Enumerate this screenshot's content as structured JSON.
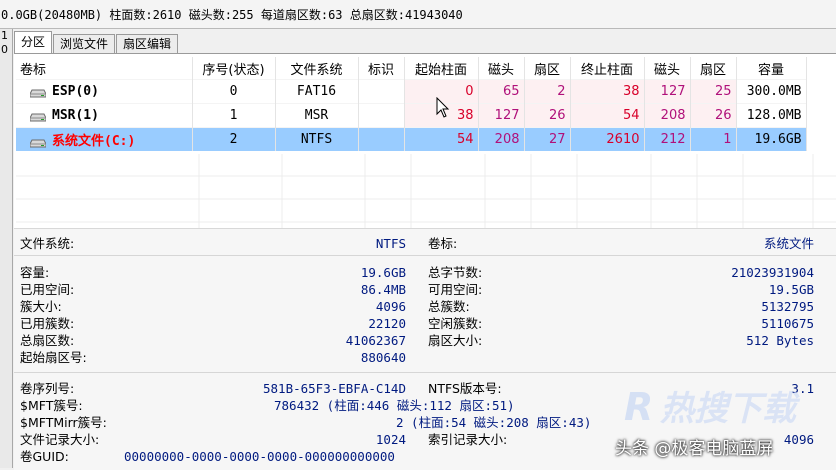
{
  "info_bar": "0.0GB(20480MB) 柱面数:2610 磁头数:255 每道扇区数:63 总扇区数:41943040",
  "left_strip": [
    "1",
    "0"
  ],
  "tabs": [
    "分区",
    "浏览文件",
    "扇区编辑"
  ],
  "table": {
    "headers": [
      "卷标",
      "序号(状态)",
      "文件系统",
      "标识",
      "起始柱面",
      "磁头",
      "扇区",
      "终止柱面",
      "磁头",
      "扇区",
      "容量"
    ],
    "rows": [
      {
        "label": "ESP(0)",
        "index": "0",
        "fs": "FAT16",
        "flag": "",
        "start_cyl": "0",
        "start_head": "65",
        "start_sec": "2",
        "end_cyl": "38",
        "end_head": "127",
        "end_sec": "25",
        "size": "300.0MB"
      },
      {
        "label": "MSR(1)",
        "index": "1",
        "fs": "MSR",
        "flag": "",
        "start_cyl": "38",
        "start_head": "127",
        "start_sec": "26",
        "end_cyl": "54",
        "end_head": "208",
        "end_sec": "26",
        "size": "128.0MB"
      },
      {
        "label": "系统文件(C:)",
        "index": "2",
        "fs": "NTFS",
        "flag": "",
        "start_cyl": "54",
        "start_head": "208",
        "start_sec": "27",
        "end_cyl": "2610",
        "end_head": "212",
        "end_sec": "1",
        "size": "19.6GB"
      }
    ]
  },
  "details": {
    "fs_label": "文件系统:",
    "fs_value": "NTFS",
    "vol_label": "卷标:",
    "vol_value": "系统文件",
    "left": [
      {
        "label": "容量:",
        "value": "19.6GB"
      },
      {
        "label": "已用空间:",
        "value": "86.4MB"
      },
      {
        "label": "簇大小:",
        "value": "4096"
      },
      {
        "label": "已用簇数:",
        "value": "22120"
      },
      {
        "label": "总扇区数:",
        "value": "41062367"
      },
      {
        "label": "起始扇区号:",
        "value": "880640"
      }
    ],
    "right": [
      {
        "label": "总字节数:",
        "value": "21023931904"
      },
      {
        "label": "可用空间:",
        "value": "19.5GB"
      },
      {
        "label": "总簇数:",
        "value": "5132795"
      },
      {
        "label": "空闲簇数:",
        "value": "5110675"
      },
      {
        "label": "扇区大小:",
        "value": "512 Bytes"
      }
    ],
    "serial_label": "卷序列号:",
    "serial_value": "581B-65F3-EBFA-C14D",
    "ntfs_ver_label": "NTFS版本号:",
    "ntfs_ver_value": "3.1",
    "mft_label": "$MFT簇号:",
    "mft_value": "786432 (柱面:446 磁头:112 扇区:51)",
    "mftmirr_label": "$MFTMirr簇号:",
    "mftmirr_value": "2 (柱面:54 磁头:208 扇区:43)",
    "rec_size_label": "文件记录大小:",
    "rec_size_value": "1024",
    "idx_size_label": "索引记录大小:",
    "idx_size_value": "4096",
    "guid_label": "卷GUID:",
    "guid_value": "00000000-0000-0000-0000-000000000000"
  },
  "watermark": {
    "footer": "头条 @极客电脑蓝屏",
    "brand_text": "热搜下载"
  },
  "colors": {
    "selected_row": "#99ccff",
    "red_value": "#d8002a",
    "magenta_value": "#b0107a",
    "system_volume": "#ff0000"
  }
}
